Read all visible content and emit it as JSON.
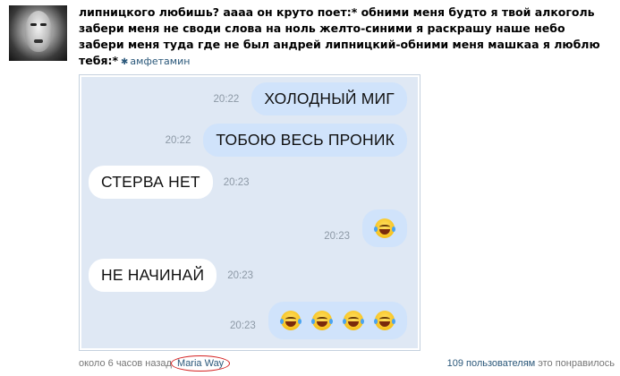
{
  "post": {
    "text": "липницкого любишь? аааа он круто поет:* обними меня будто я твой алкоголь\nзабери меня не своди слова на ноль желто-синими я раскрашу наше небо\nзабери меня туда где не был андрей липницкий-обними меня машкаа я люблю\nтебя:*",
    "author_icon": "✱",
    "author": "амфетамин"
  },
  "chat": {
    "messages": [
      {
        "text": "ХОЛОДНЫЙ МИГ",
        "time": "20:22",
        "direction": "out"
      },
      {
        "text": "ТОБОЮ ВЕСЬ ПРОНИК",
        "time": "20:22",
        "direction": "out"
      },
      {
        "text": "СТЕРВА НЕТ",
        "time": "20:23",
        "direction": "in"
      },
      {
        "emoji": "tears-of-joy",
        "count": 1,
        "time": "20:23",
        "direction": "out"
      },
      {
        "text": "НЕ НАЧИНАЙ",
        "time": "20:23",
        "direction": "in"
      },
      {
        "emoji": "tears-of-joy",
        "count": 4,
        "time": "20:23",
        "direction": "out"
      }
    ]
  },
  "footer": {
    "time_ago": "около 6 часов назад",
    "mention": "Maria Way",
    "likes_count": "109 пользователям",
    "likes_suffix": " это понравилось"
  },
  "colors": {
    "link": "#2b587a",
    "chat_background": "#dfe8f4",
    "bubble_out": "#d0e3fb",
    "bubble_in": "#ffffff",
    "highlight_circle": "#d42020"
  }
}
